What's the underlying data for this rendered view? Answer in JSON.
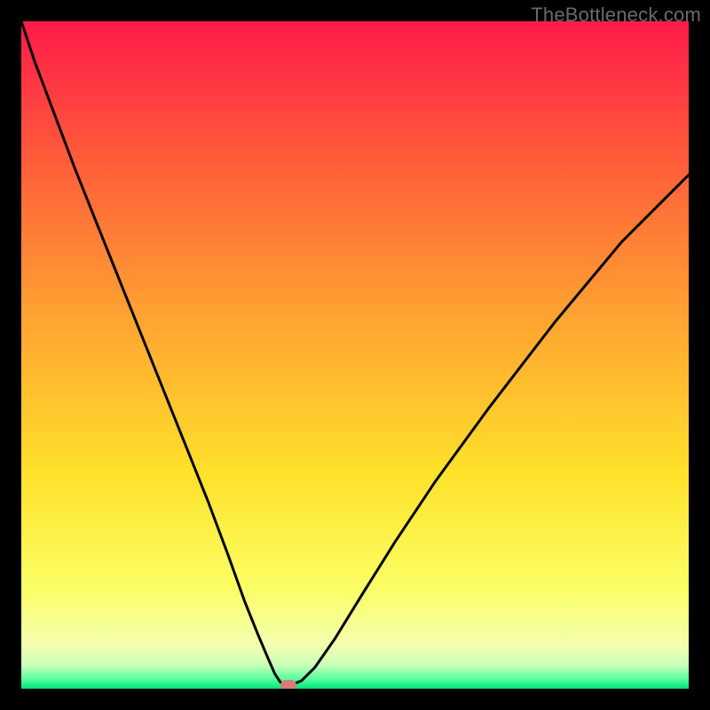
{
  "watermark": "TheBottleneck.com",
  "colors": {
    "frame": "#000000",
    "curve": "#000000",
    "marker": "#d87a7a",
    "gradient_stops": [
      {
        "offset": 0.0,
        "color": "#ff1a4a"
      },
      {
        "offset": 0.2,
        "color": "#ff5a3a"
      },
      {
        "offset": 0.45,
        "color": "#ffa531"
      },
      {
        "offset": 0.68,
        "color": "#ffe22a"
      },
      {
        "offset": 0.85,
        "color": "#fbff66"
      },
      {
        "offset": 0.935,
        "color": "#f3ffb0"
      },
      {
        "offset": 0.965,
        "color": "#c9ffb9"
      },
      {
        "offset": 0.985,
        "color": "#5bff9e"
      },
      {
        "offset": 1.0,
        "color": "#00e47a"
      }
    ]
  },
  "chart_data": {
    "type": "line",
    "title": "",
    "xlabel": "",
    "ylabel": "",
    "xlim": [
      0,
      100
    ],
    "ylim": [
      0,
      100
    ],
    "series": [
      {
        "name": "bottleneck-curve",
        "x": [
          0,
          2,
          5,
          8,
          12,
          16,
          20,
          24,
          28,
          31,
          33.5,
          35.5,
          37,
          38,
          38.8,
          39.5,
          40.5,
          42,
          44,
          47,
          51,
          56,
          62,
          70,
          80,
          90,
          100
        ],
        "y": [
          100,
          94,
          86,
          78,
          68,
          58,
          48,
          38,
          28,
          20,
          13,
          8,
          4.5,
          2.2,
          1.0,
          0.6,
          0.6,
          1.2,
          3.2,
          7.5,
          14,
          22,
          31,
          42,
          55,
          67,
          77
        ]
      }
    ],
    "annotations": [
      {
        "name": "minimum-marker",
        "x": 40,
        "y": 0.5
      }
    ],
    "grid": false,
    "legend": false
  }
}
